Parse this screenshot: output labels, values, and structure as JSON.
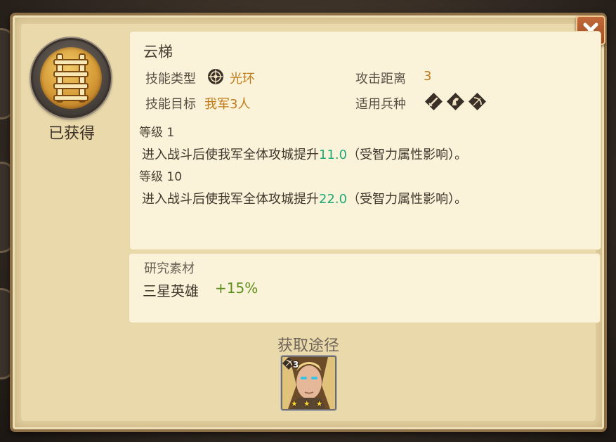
{
  "dialog": {
    "status": "已获得",
    "close_icon": "close-icon"
  },
  "skill": {
    "name": "云梯",
    "icon": "ladder-icon",
    "type_label": "技能类型",
    "type_value": "光环",
    "type_icon": "aura-icon",
    "range_label": "攻击距离",
    "range_value": "3",
    "target_label": "技能目标",
    "target_value": "我军3人",
    "troops_label": "适用兵种",
    "troop_icons": [
      "sword-icon",
      "horse-icon",
      "bow-icon"
    ]
  },
  "levels": [
    {
      "label": "等级 1",
      "desc_prefix": "进入战斗后使我军全体攻城提升",
      "value": "11.0",
      "desc_suffix": "（受智力属性影响）。"
    },
    {
      "label": "等级 10",
      "desc_prefix": "进入战斗后使我军全体攻城提升",
      "value": "22.0",
      "desc_suffix": "（受智力属性影响）。"
    }
  ],
  "material": {
    "title": "研究素材",
    "name": "三星英雄",
    "bonus": "+15%"
  },
  "source": {
    "title": "获取途径",
    "hero": {
      "level": "3",
      "stars": 3,
      "badge_icon": "bow-icon"
    }
  },
  "colors": {
    "accent_orange": "#c07a1a",
    "value_green": "#1fa774",
    "bonus_green": "#5c8f1c"
  }
}
